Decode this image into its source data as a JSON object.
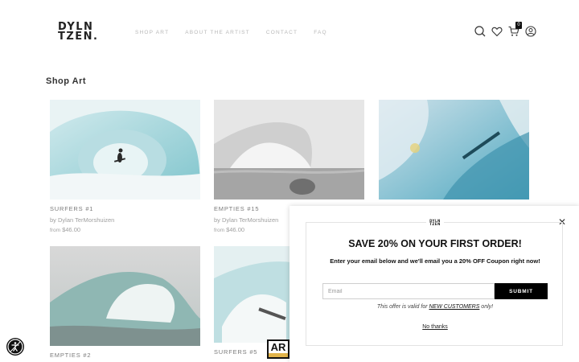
{
  "header": {
    "logo_line1": "DYLN",
    "logo_line2": "TZEN.",
    "nav": [
      "SHOP ART",
      "ABOUT THE ARTIST",
      "CONTACT",
      "FAQ"
    ],
    "icons": [
      "search-icon",
      "heart-icon",
      "cart-icon",
      "account-icon"
    ],
    "cart_count": "0"
  },
  "page": {
    "heading": "Shop Art"
  },
  "products": [
    {
      "title": "SURFERS #1",
      "artist": "by Dylan TerMorshuizen",
      "price_prefix": "from",
      "price": "$46.00"
    },
    {
      "title": "EMPTIES #15",
      "artist": "by Dylan TerMorshuizen",
      "price_prefix": "from",
      "price": "$46.00"
    },
    {
      "title": "",
      "artist": "",
      "price_prefix": "",
      "price": ""
    },
    {
      "title": "EMPTIES #2",
      "artist": "",
      "price_prefix": "",
      "price": ""
    },
    {
      "title": "SURFERS #5",
      "artist": "",
      "price_prefix": "",
      "price": ""
    }
  ],
  "popup": {
    "logo_line1": "DYLN",
    "logo_line2": "TZEN",
    "close_label": "✕",
    "title": "SAVE 20% ON YOUR FIRST ORDER!",
    "subtitle": "Enter your email below and we'll email you a 20% OFF Coupon right now!",
    "email_placeholder": "Email",
    "email_value": "",
    "submit_label": "SUBMIT",
    "offer_note_prefix": "This offer is valid for ",
    "offer_note_link": "NEW CUSTOMERS",
    "offer_note_suffix": " only!",
    "no_thanks": "No thanks"
  },
  "ar_badge": {
    "label": "AR"
  },
  "accessibility": {
    "icon": "accessibility-icon"
  }
}
